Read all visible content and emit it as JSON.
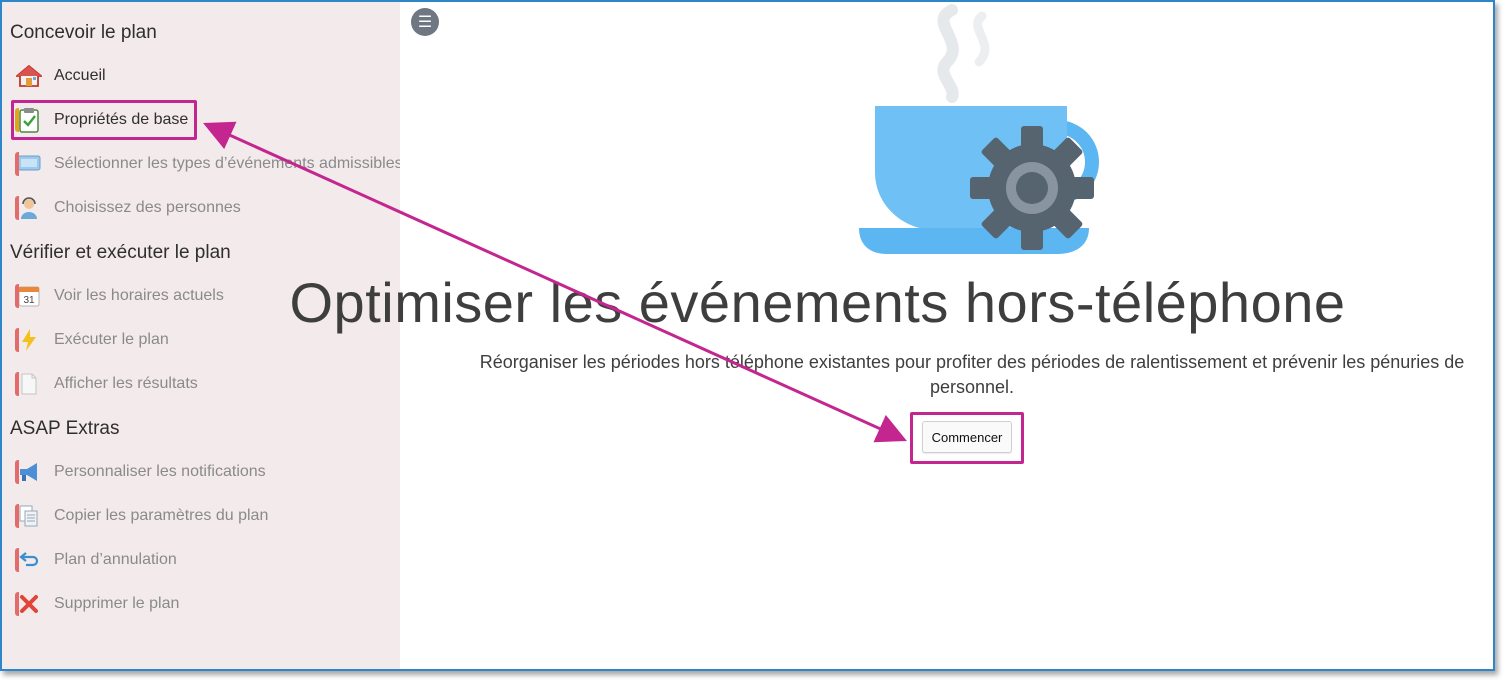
{
  "sidebar": {
    "sections": [
      {
        "title": "Concevoir le plan",
        "items": [
          {
            "label": "Accueil",
            "icon": "home-icon"
          },
          {
            "label": "Propriétés de base",
            "icon": "clipboard-check-icon"
          },
          {
            "label": "Sélectionner les types d’événements admissibles",
            "icon": "monitor-icon"
          },
          {
            "label": "Choisissez des personnes",
            "icon": "person-headset-icon"
          }
        ]
      },
      {
        "title": "Vérifier et exécuter le plan",
        "items": [
          {
            "label": "Voir les horaires actuels",
            "icon": "calendar-icon",
            "calendar_day": "31"
          },
          {
            "label": "Exécuter le plan",
            "icon": "lightning-icon"
          },
          {
            "label": "Afficher les résultats",
            "icon": "document-icon"
          }
        ]
      },
      {
        "title": "ASAP Extras",
        "items": [
          {
            "label": "Personnaliser les notifications",
            "icon": "megaphone-icon"
          },
          {
            "label": "Copier les paramètres du plan",
            "icon": "copy-icon"
          },
          {
            "label": "Plan d’annulation",
            "icon": "undo-arrow-icon"
          },
          {
            "label": "Supprimer le plan",
            "icon": "delete-x-icon"
          }
        ]
      }
    ]
  },
  "main": {
    "title": "Optimiser les événements hors-téléphone",
    "subtitle": "Réorganiser les périodes hors téléphone existantes pour profiter des périodes de ralentissement et prévenir les pénuries de personnel.",
    "start_button": "Commencer"
  },
  "colors": {
    "sidebar_bg": "#f3eaec",
    "highlight": "#c4268f",
    "frame_border": "#2e86c9",
    "cup_blue": "#5bb6f2",
    "gear_gray": "#566470"
  }
}
